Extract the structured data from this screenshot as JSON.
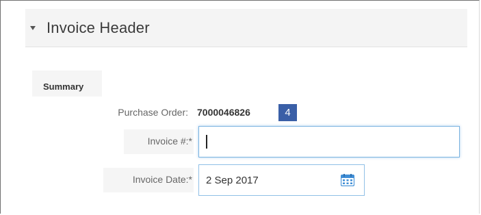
{
  "section": {
    "title": "Invoice Header",
    "collapse_icon": "caret-down-icon"
  },
  "summary": {
    "label": "Summary",
    "purchase_order": {
      "label": "Purchase Order:",
      "value": "7000046826"
    },
    "step_badge": "4",
    "invoice_number": {
      "label": "Invoice #:*",
      "value": "",
      "focused": true
    },
    "invoice_date": {
      "label": "Invoice Date:*",
      "value": "2 Sep 2017",
      "icon": "calendar-icon"
    }
  },
  "colors": {
    "badge": "#3a5fa7",
    "focus_border": "#7ab3e0",
    "calendar": "#3f8ed6"
  }
}
